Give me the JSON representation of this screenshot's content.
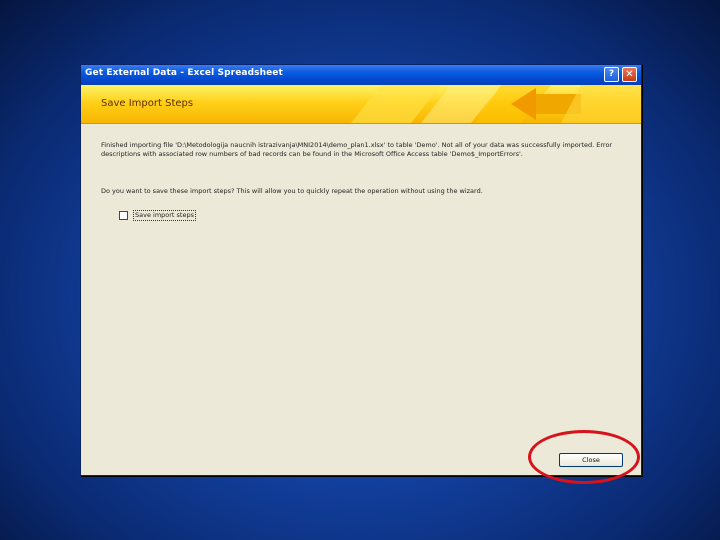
{
  "dialog": {
    "title": "Get External Data - Excel Spreadsheet",
    "help_glyph": "?",
    "close_glyph": "✕"
  },
  "banner": {
    "title": "Save Import Steps"
  },
  "content": {
    "finished_message": "Finished importing file 'D:\\Metodologija naucnih istrazivanja\\MNI2014\\demo_plan1.xlsx' to table 'Demo'. Not all of your data was successfully imported. Error descriptions with associated row numbers of bad records can be found in the Microsoft Office Access table 'Demo$_ImportErrors'.",
    "question": "Do you want to save these import steps? This will allow you to quickly repeat the operation without using the wizard.",
    "save_checkbox_label": "Save import steps",
    "save_checkbox_checked": false
  },
  "buttons": {
    "close_label": "Close"
  },
  "colors": {
    "background": "#123f9c",
    "titlebar": "#0a5ce0",
    "banner": "#ffd11a",
    "highlight": "#d8121a"
  }
}
